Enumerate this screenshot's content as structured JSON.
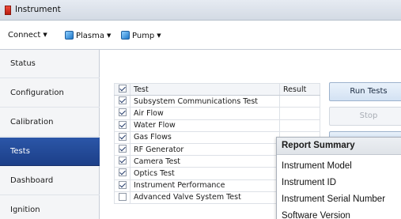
{
  "window": {
    "title": "Instrument"
  },
  "menubar": {
    "items": [
      {
        "label": "Connect",
        "icon": ""
      },
      {
        "label": "Plasma",
        "icon": "plasma-icon"
      },
      {
        "label": "Pump",
        "icon": "pump-icon"
      }
    ]
  },
  "sidebar": {
    "items": [
      {
        "label": "Status",
        "active": false
      },
      {
        "label": "Configuration",
        "active": false
      },
      {
        "label": "Calibration",
        "active": false
      },
      {
        "label": "Tests",
        "active": true
      },
      {
        "label": "Dashboard",
        "active": false
      },
      {
        "label": "Ignition",
        "active": false
      }
    ]
  },
  "tests": {
    "columns": {
      "test": "Test",
      "result": "Result"
    },
    "rows": [
      {
        "name": "Subsystem Communications Test",
        "checked": true,
        "result": ""
      },
      {
        "name": "Air Flow",
        "checked": true,
        "result": ""
      },
      {
        "name": "Water Flow",
        "checked": true,
        "result": ""
      },
      {
        "name": "Gas Flows",
        "checked": true,
        "result": ""
      },
      {
        "name": "RF Generator",
        "checked": true,
        "result": ""
      },
      {
        "name": "Camera Test",
        "checked": true,
        "result": ""
      },
      {
        "name": "Optics Test",
        "checked": true,
        "result": ""
      },
      {
        "name": "Instrument Performance",
        "checked": true,
        "result": ""
      },
      {
        "name": "Advanced Valve System Test",
        "checked": false,
        "result": ""
      }
    ]
  },
  "buttons": {
    "run_tests": "Run Tests",
    "stop": "Stop"
  },
  "report_summary": {
    "title": "Report Summary",
    "items": [
      "Instrument Model",
      "Instrument ID",
      "Instrument Serial Number",
      "Software Version"
    ]
  },
  "colors": {
    "nav_active": "#2b56a8",
    "titlebar": "#dbe1ea"
  }
}
